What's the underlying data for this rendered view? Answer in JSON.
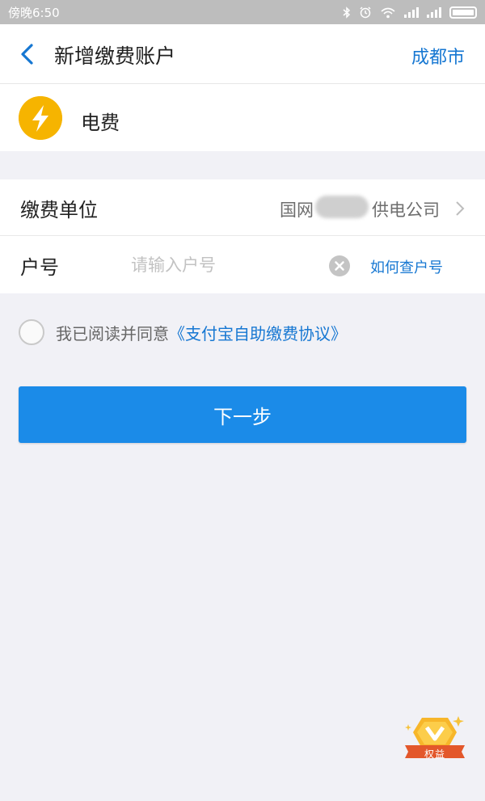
{
  "status_bar": {
    "time": "傍晚6:50"
  },
  "nav": {
    "title": "新增缴费账户",
    "city": "成都市"
  },
  "bill_type": {
    "label": "电费",
    "icon": "lightning-bolt-icon",
    "icon_color": "#f6b400"
  },
  "form": {
    "unit_label": "缴费单位",
    "unit_value_prefix": "国网",
    "unit_value_suffix": "供电公司",
    "account_label": "户号",
    "account_placeholder": "请输入户号",
    "account_value": "",
    "howto_link": "如何查户号"
  },
  "agreement": {
    "text": "我已阅读并同意",
    "link": "《支付宝自助缴费协议》",
    "checked": false
  },
  "next_button": {
    "label": "下一步",
    "color": "#1b8be8"
  },
  "rights_badge": {
    "label": "权益"
  },
  "colors": {
    "accent": "#1677d2",
    "background": "#f1f1f6"
  }
}
